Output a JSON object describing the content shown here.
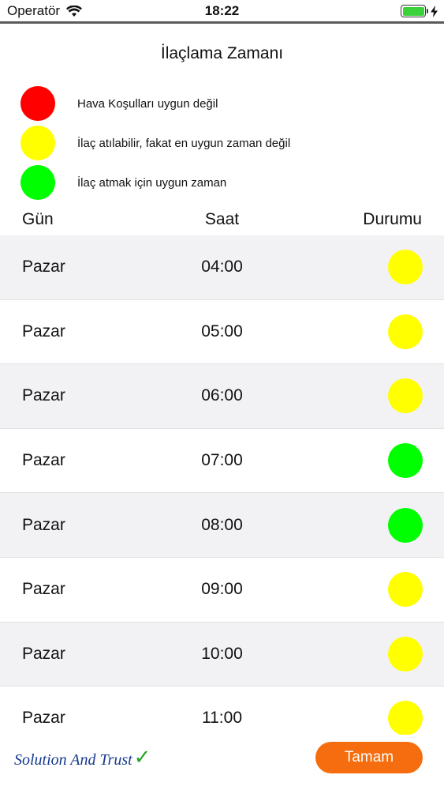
{
  "status_bar": {
    "carrier": "Operatör",
    "time": "18:22"
  },
  "screen": {
    "title": "İlaçlama Zamanı"
  },
  "legend": [
    {
      "color": "#ff0000",
      "label": "Hava Koşulları  uygun değil"
    },
    {
      "color": "#ffff00",
      "label": "İlaç atılabilir, fakat en uygun zaman değil"
    },
    {
      "color": "#00ff00",
      "label": "İlaç atmak için uygun zaman"
    }
  ],
  "table": {
    "headers": {
      "day": "Gün",
      "time": "Saat",
      "status": "Durumu"
    },
    "rows": [
      {
        "day": "Pazar",
        "time": "04:00",
        "status_color": "#ffff00"
      },
      {
        "day": "Pazar",
        "time": "05:00",
        "status_color": "#ffff00"
      },
      {
        "day": "Pazar",
        "time": "06:00",
        "status_color": "#ffff00"
      },
      {
        "day": "Pazar",
        "time": "07:00",
        "status_color": "#00ff00"
      },
      {
        "day": "Pazar",
        "time": "08:00",
        "status_color": "#00ff00"
      },
      {
        "day": "Pazar",
        "time": "09:00",
        "status_color": "#ffff00"
      },
      {
        "day": "Pazar",
        "time": "10:00",
        "status_color": "#ffff00"
      },
      {
        "day": "Pazar",
        "time": "11:00",
        "status_color": "#ffff00"
      }
    ]
  },
  "footer": {
    "logo_text": "Solution And Trust",
    "ok_button": "Tamam"
  }
}
